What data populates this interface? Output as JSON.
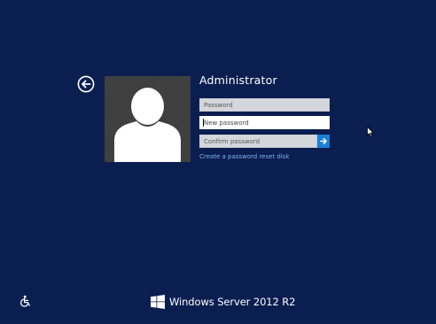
{
  "user": {
    "name": "Administrator"
  },
  "form": {
    "password_placeholder": "Password",
    "new_password_placeholder": "New password",
    "confirm_password_placeholder": "Confirm password",
    "reset_link_label": "Create a password reset disk"
  },
  "footer": {
    "product_name": "Windows Server 2012 R2"
  },
  "icons": {
    "back": "back-arrow-icon",
    "avatar": "user-silhouette-icon",
    "submit": "arrow-right-icon",
    "ease_of_access": "ease-of-access-icon",
    "logo": "windows-logo-icon",
    "cursor": "mouse-pointer-icon"
  },
  "colors": {
    "background": "#0b1e50",
    "accent": "#1a7fd6",
    "link": "#7fb4f0",
    "avatar_background": "#3d3d3d"
  }
}
